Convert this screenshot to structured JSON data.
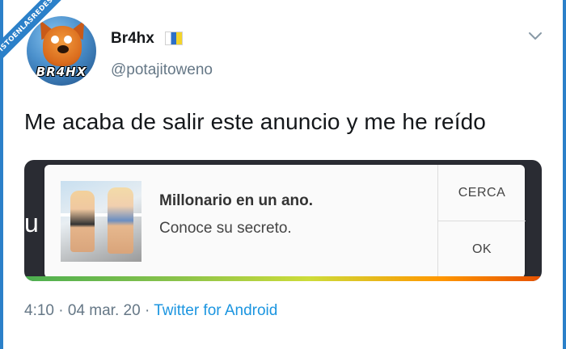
{
  "watermark": {
    "text": "VISTOENLASREDES"
  },
  "author": {
    "display_name": "Br4hx",
    "handle": "@potajitoweno",
    "avatar_label": "BR4HX"
  },
  "tweet": {
    "text": "Me acaba de salir este anuncio y me he reído",
    "time": "4:10",
    "separator": "·",
    "date": "04 mar. 20",
    "source": "Twitter for Android"
  },
  "media": {
    "partial_left_text": "u",
    "ad_dialog": {
      "title": "Millonario en un ano.",
      "subtitle": "Conoce su secreto.",
      "buttons": [
        "CERCA",
        "OK"
      ]
    }
  },
  "icons": {
    "menu": "chevron-down-icon",
    "flag": "canary-islands-flag-icon"
  },
  "colors": {
    "link": "#1b95e0",
    "secondary_text": "#657786",
    "watermark": "#2b80c9"
  }
}
